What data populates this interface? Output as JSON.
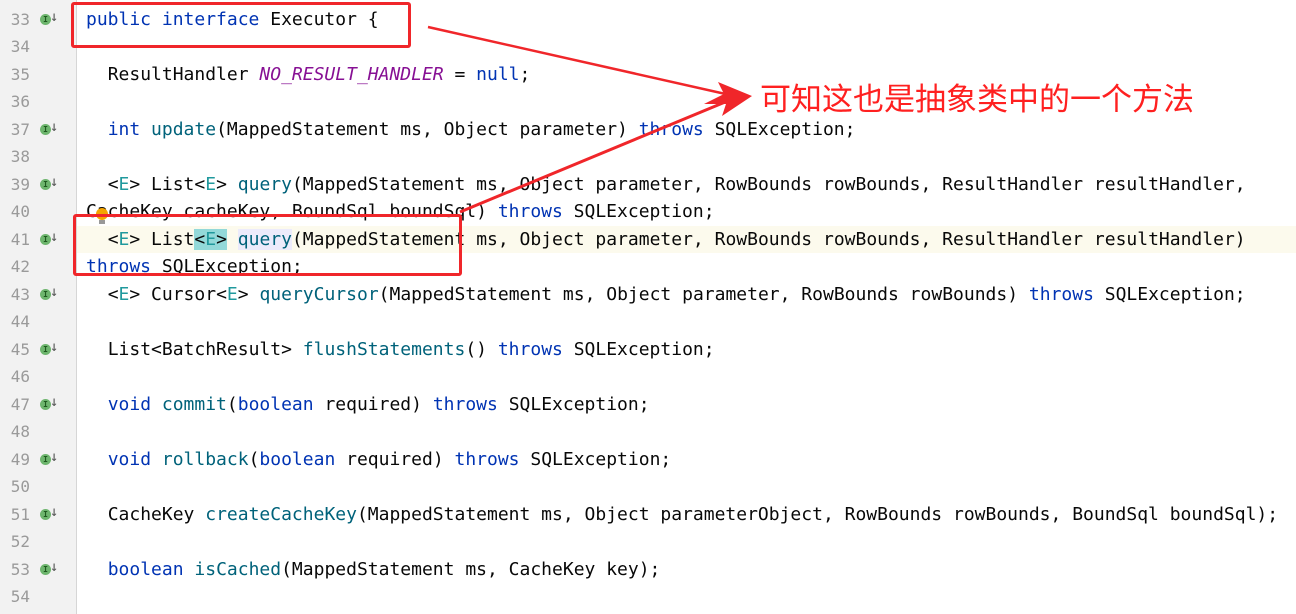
{
  "editor": {
    "first_line_number": 33,
    "current_line": 41,
    "lines": [
      {
        "n": "33",
        "impl": true,
        "tokens": [
          [
            "public ",
            "kw"
          ],
          [
            "interface ",
            "kw"
          ],
          [
            "Executor {",
            ""
          ]
        ]
      },
      {
        "n": "34",
        "impl": false,
        "tokens": []
      },
      {
        "n": "35",
        "impl": false,
        "tokens": [
          [
            "  ResultHandler ",
            ""
          ],
          [
            "NO_RESULT_HANDLER",
            "cst"
          ],
          [
            " = ",
            ""
          ],
          [
            "null",
            "kw"
          ],
          [
            ";",
            ""
          ]
        ]
      },
      {
        "n": "36",
        "impl": false,
        "tokens": []
      },
      {
        "n": "37",
        "impl": true,
        "tokens": [
          [
            "  ",
            ""
          ],
          [
            "int ",
            "kw"
          ],
          [
            "update",
            "fn"
          ],
          [
            "(MappedStatement ms, Object parameter) ",
            ""
          ],
          [
            "throws ",
            "kw"
          ],
          [
            "SQLException;",
            ""
          ]
        ]
      },
      {
        "n": "38",
        "impl": false,
        "tokens": []
      },
      {
        "n": "39",
        "impl": true,
        "tokens": [
          [
            "  <",
            ""
          ],
          [
            "E",
            "tp"
          ],
          [
            "> List<",
            ""
          ],
          [
            "E",
            "tp"
          ],
          [
            "> ",
            ""
          ],
          [
            "query",
            "fn"
          ],
          [
            "(MappedStatement ms, Object parameter, RowBounds rowBounds, ResultHandler resultHandler, CacheKey cacheKey, BoundSql boundSql) ",
            ""
          ],
          [
            "throws ",
            "kw"
          ],
          [
            "SQLException;",
            ""
          ]
        ]
      },
      {
        "n": "40",
        "impl": false,
        "tokens": []
      },
      {
        "n": "41",
        "impl": true,
        "tokens": [
          [
            "  <",
            ""
          ],
          [
            "E",
            "tp"
          ],
          [
            "> List",
            ""
          ],
          [
            "<",
            "tphl"
          ],
          [
            "E",
            "tp tphl"
          ],
          [
            ">",
            "tphl"
          ],
          [
            " ",
            ""
          ],
          [
            "|",
            "caret"
          ],
          [
            "query",
            "fn fnhl"
          ],
          [
            "(MappedStatement ms, Object parameter, RowBounds rowBounds, ResultHandler resultHandler) ",
            ""
          ],
          [
            "throws ",
            "kw"
          ],
          [
            "SQLException;",
            ""
          ]
        ]
      },
      {
        "n": "42",
        "impl": false,
        "tokens": []
      },
      {
        "n": "43",
        "impl": true,
        "tokens": [
          [
            "  <",
            ""
          ],
          [
            "E",
            "tp"
          ],
          [
            "> Cursor<",
            ""
          ],
          [
            "E",
            "tp"
          ],
          [
            "> ",
            ""
          ],
          [
            "queryCursor",
            "fn"
          ],
          [
            "(MappedStatement ms, Object parameter, RowBounds rowBounds) ",
            ""
          ],
          [
            "throws ",
            "kw"
          ],
          [
            "SQLException;",
            ""
          ]
        ]
      },
      {
        "n": "44",
        "impl": false,
        "tokens": []
      },
      {
        "n": "45",
        "impl": true,
        "tokens": [
          [
            "  List<BatchResult> ",
            ""
          ],
          [
            "flushStatements",
            "fn"
          ],
          [
            "() ",
            ""
          ],
          [
            "throws ",
            "kw"
          ],
          [
            "SQLException;",
            ""
          ]
        ]
      },
      {
        "n": "46",
        "impl": false,
        "tokens": []
      },
      {
        "n": "47",
        "impl": true,
        "tokens": [
          [
            "  ",
            ""
          ],
          [
            "void ",
            "kw"
          ],
          [
            "commit",
            "fn"
          ],
          [
            "(",
            ""
          ],
          [
            "boolean ",
            "kw"
          ],
          [
            "required) ",
            ""
          ],
          [
            "throws ",
            "kw"
          ],
          [
            "SQLException;",
            ""
          ]
        ]
      },
      {
        "n": "48",
        "impl": false,
        "tokens": []
      },
      {
        "n": "49",
        "impl": true,
        "tokens": [
          [
            "  ",
            ""
          ],
          [
            "void ",
            "kw"
          ],
          [
            "rollback",
            "fn"
          ],
          [
            "(",
            ""
          ],
          [
            "boolean ",
            "kw"
          ],
          [
            "required) ",
            ""
          ],
          [
            "throws ",
            "kw"
          ],
          [
            "SQLException;",
            ""
          ]
        ]
      },
      {
        "n": "50",
        "impl": false,
        "tokens": []
      },
      {
        "n": "51",
        "impl": true,
        "tokens": [
          [
            "  CacheKey ",
            ""
          ],
          [
            "createCacheKey",
            "fn"
          ],
          [
            "(MappedStatement ms, Object parameterObject, RowBounds rowBounds, BoundSql boundSql);",
            ""
          ]
        ]
      },
      {
        "n": "52",
        "impl": false,
        "tokens": []
      },
      {
        "n": "53",
        "impl": true,
        "tokens": [
          [
            "  ",
            ""
          ],
          [
            "boolean ",
            "kw"
          ],
          [
            "isCached",
            "fn"
          ],
          [
            "(MappedStatement ms, CacheKey key);",
            ""
          ]
        ]
      },
      {
        "n": "54",
        "impl": false,
        "tokens": []
      }
    ]
  },
  "annotation": {
    "note": "可知这也是抽象类中的一个方法",
    "color": "#ff2020"
  }
}
